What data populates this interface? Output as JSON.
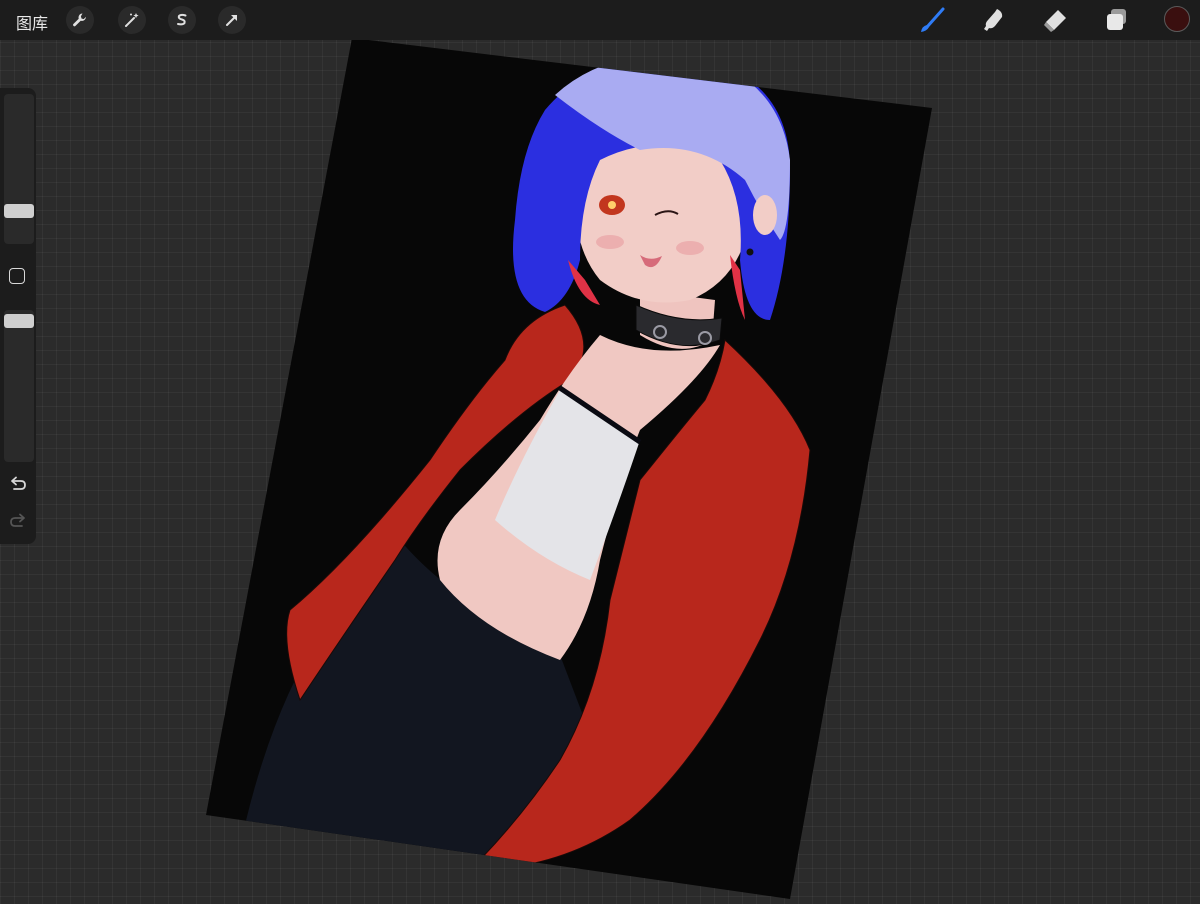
{
  "topbar": {
    "gallery_label": "图库",
    "left_tools": [
      "wrench-icon",
      "magic-wand-icon",
      "selection-icon",
      "transform-arrow-icon"
    ],
    "right_tools": [
      "brush-icon",
      "smudge-icon",
      "eraser-icon",
      "layers-icon"
    ],
    "active_tool": "brush-icon",
    "active_color": "#3a0f0f",
    "accent_color": "#2f7cf6"
  },
  "sidebar": {
    "brush_size_level": 0.5,
    "opacity_level": 0.95,
    "modify_button": "square-icon",
    "undo": "undo-icon",
    "redo": "redo-icon"
  },
  "canvas": {
    "content": "artwork-illustration",
    "colors": {
      "background": "#070707",
      "hair": "#2b2fe0",
      "hair_highlight": "#a9abf2",
      "jacket": "#b8271c",
      "skin": "#f0c8c2",
      "top": "#e4e4e8",
      "pants": "#121620"
    }
  }
}
